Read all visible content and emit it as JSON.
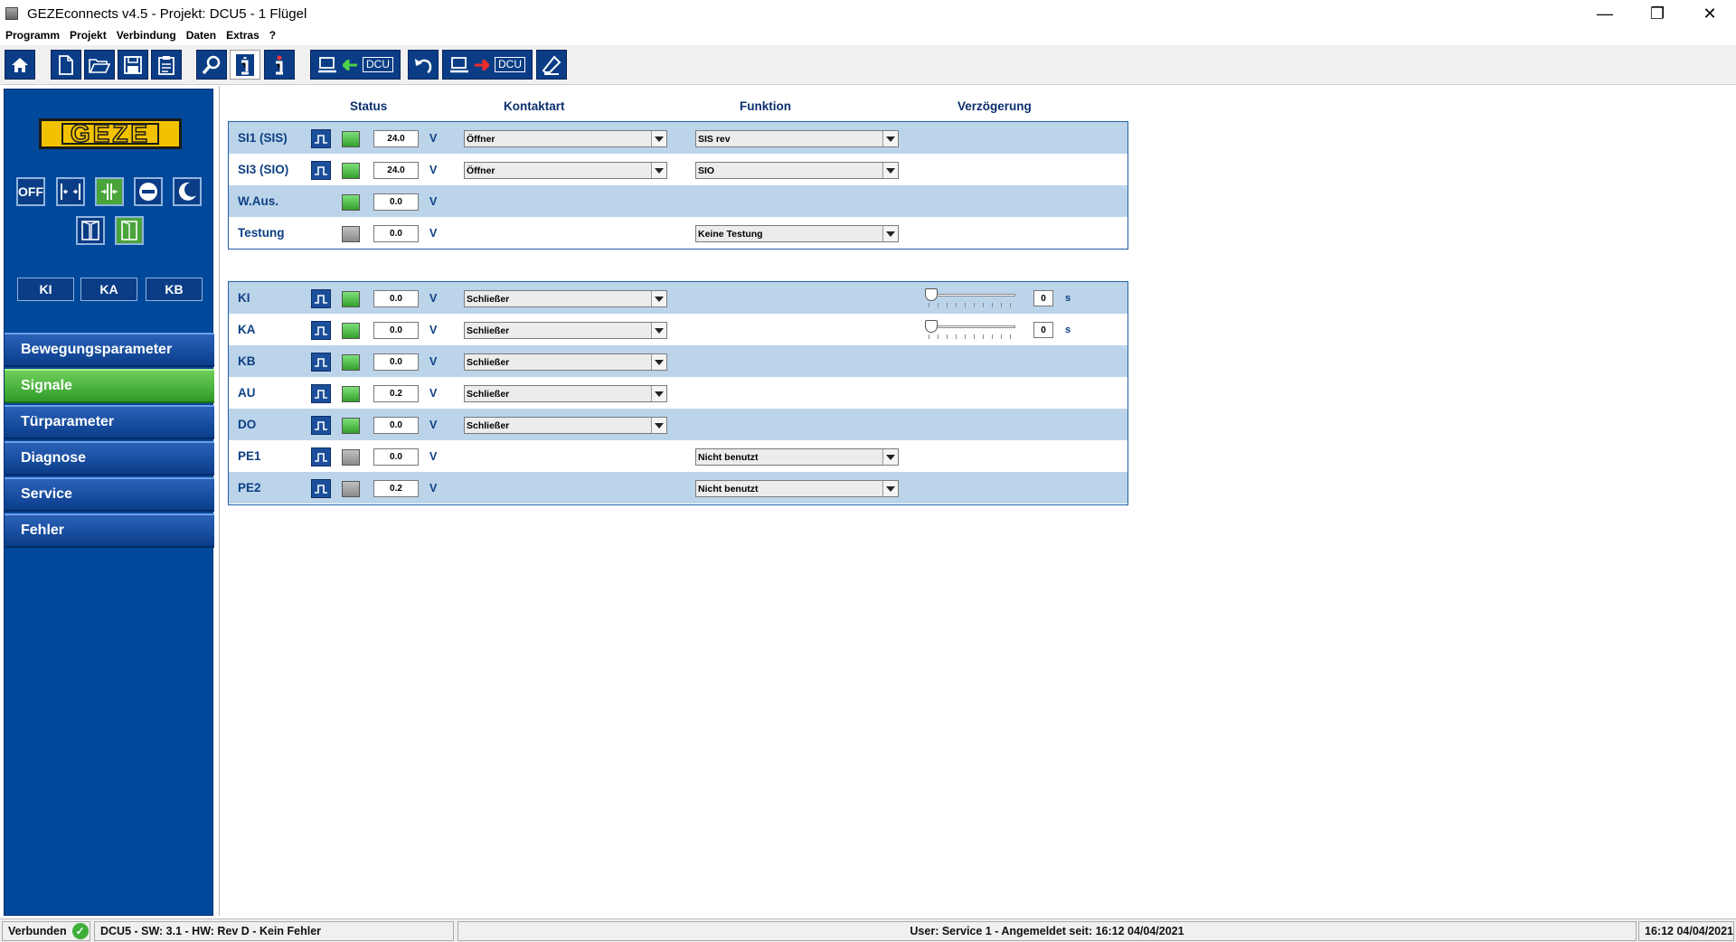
{
  "window": {
    "title": "GEZEconnects v4.5 - Projekt: DCU5 - 1 Flügel",
    "minimize": "—",
    "restore": "❐",
    "close": "✕"
  },
  "menu": [
    "Programm",
    "Projekt",
    "Verbindung",
    "Daten",
    "Extras",
    "?"
  ],
  "toolbar": {
    "dcu_label": "DCU",
    "icons": [
      "home-icon",
      "new-file-icon",
      "open-folder-icon",
      "save-icon",
      "clipboard-icon",
      "search-icon",
      "info-icon",
      "info-red-icon",
      "computer-from-dcu-icon",
      "undo-icon",
      "computer-to-dcu-icon",
      "eraser-icon"
    ]
  },
  "sidebar": {
    "logo": "GEZE",
    "modes": [
      "OFF"
    ],
    "small_buttons": [
      "KI",
      "KA",
      "KB"
    ],
    "nav": [
      {
        "label": "Bewegungsparameter",
        "active": false
      },
      {
        "label": "Signale",
        "active": true
      },
      {
        "label": "Türparameter",
        "active": false
      },
      {
        "label": "Diagnose",
        "active": false
      },
      {
        "label": "Service",
        "active": false
      },
      {
        "label": "Fehler",
        "active": false
      }
    ]
  },
  "columns": {
    "status": "Status",
    "kontaktart": "Kontaktart",
    "funktion": "Funktion",
    "verzoegerung": "Verzögerung"
  },
  "unit_v": "V",
  "unit_s": "s",
  "panel1": [
    {
      "label": "SI1 (SIS)",
      "signal_button": true,
      "led": "green",
      "voltage": "24.0",
      "kontaktart": "Öffner",
      "funktion": "SIS rev"
    },
    {
      "label": "SI3 (SIO)",
      "signal_button": true,
      "led": "green",
      "voltage": "24.0",
      "kontaktart": "Öffner",
      "funktion": "SIO"
    },
    {
      "label": "W.Aus.",
      "signal_button": false,
      "led": "green",
      "voltage": "0.0",
      "kontaktart": "",
      "funktion": ""
    },
    {
      "label": "Testung",
      "signal_button": false,
      "led": "grey",
      "voltage": "0.0",
      "kontaktart": "",
      "funktion": "Keine Testung"
    }
  ],
  "panel2": [
    {
      "label": "KI",
      "led": "green",
      "voltage": "0.0",
      "kontaktart": "Schließer",
      "funktion": "",
      "delay": "0",
      "delay_fraction": 0
    },
    {
      "label": "KA",
      "led": "green",
      "voltage": "0.0",
      "kontaktart": "Schließer",
      "funktion": "",
      "delay": "0",
      "delay_fraction": 0
    },
    {
      "label": "KB",
      "led": "green",
      "voltage": "0.0",
      "kontaktart": "Schließer",
      "funktion": ""
    },
    {
      "label": "AU",
      "led": "green",
      "voltage": "0.2",
      "kontaktart": "Schließer",
      "funktion": ""
    },
    {
      "label": "DO",
      "led": "green",
      "voltage": "0.0",
      "kontaktart": "Schließer",
      "funktion": ""
    },
    {
      "label": "PE1",
      "led": "grey",
      "voltage": "0.0",
      "kontaktart": "",
      "funktion": "Nicht benutzt"
    },
    {
      "label": "PE2",
      "led": "grey",
      "voltage": "0.2",
      "kontaktart": "",
      "funktion": "Nicht benutzt"
    }
  ],
  "statusbar": {
    "connection": "Verbunden",
    "device": "DCU5 -  SW: 3.1 -  HW: Rev D - Kein Fehler",
    "user": "User: Service 1 - Angemeldet seit:  16:12  04/04/2021",
    "clock": "16:12  04/04/2021"
  },
  "colors": {
    "brand_blue": "#00489a",
    "active_green": "#49a43a",
    "row_shade": "#bcd4ea",
    "logo_yellow": "#f2c200"
  }
}
